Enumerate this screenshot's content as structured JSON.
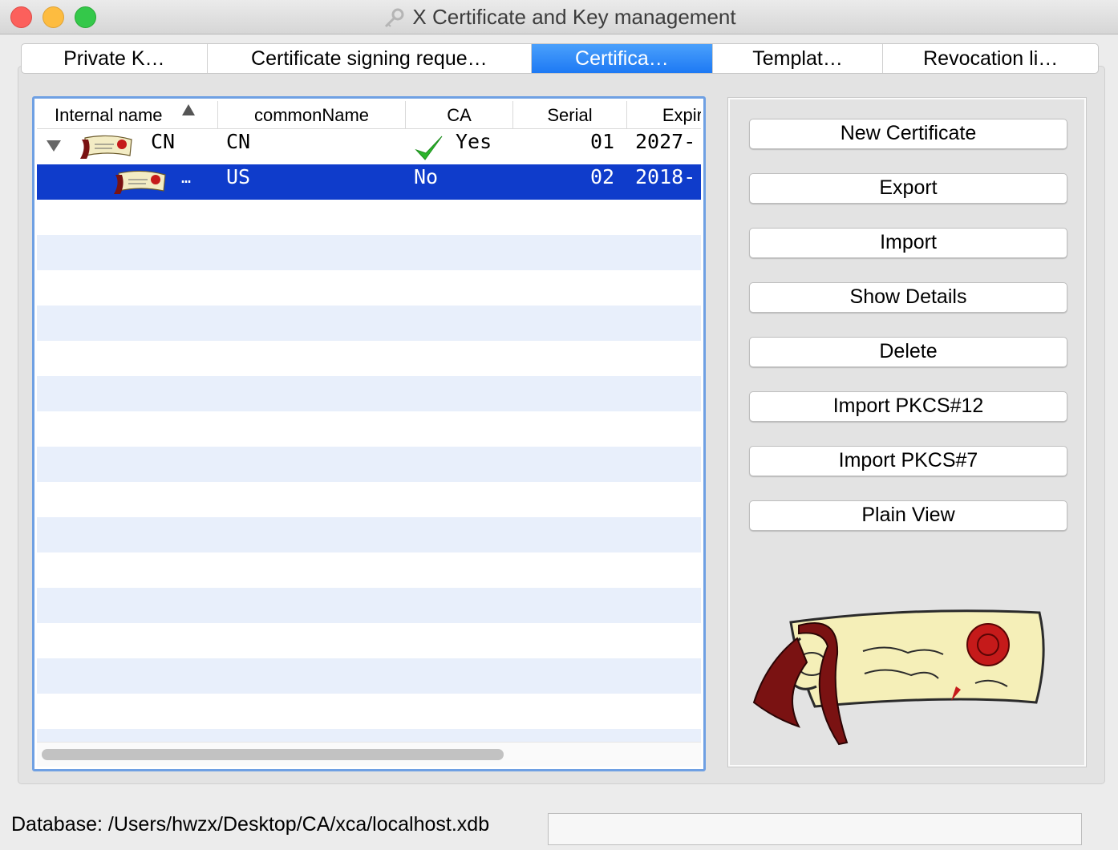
{
  "window": {
    "title": "X Certificate and Key management",
    "title_icon": "key-icon"
  },
  "tabs": [
    {
      "label": "Private K…",
      "active": false
    },
    {
      "label": "Certificate signing reque…",
      "active": false
    },
    {
      "label": "Certifica…",
      "active": true
    },
    {
      "label": "Templat…",
      "active": false
    },
    {
      "label": "Revocation li…",
      "active": false
    }
  ],
  "table": {
    "columns": [
      "Internal name",
      "commonName",
      "CA",
      "Serial",
      "Expir"
    ],
    "sort_column": "Internal name",
    "rows": [
      {
        "internal_name": "CN",
        "common_name": "CN",
        "ca": "Yes",
        "serial": "01",
        "expiry": "2027-",
        "ca_icon": "checkmark-icon",
        "expanded": true,
        "selected": false,
        "level": 0
      },
      {
        "internal_name": "…",
        "common_name": "US",
        "ca": "No",
        "serial": "02",
        "expiry": "2018-",
        "expanded": false,
        "selected": true,
        "level": 1
      }
    ]
  },
  "buttons": [
    "New Certificate",
    "Export",
    "Import",
    "Show Details",
    "Delete",
    "Import PKCS#12",
    "Import PKCS#7",
    "Plain View"
  ],
  "status": {
    "database": "Database: /Users/hwzx/Desktop/CA/xca/localhost.xdb"
  },
  "colors": {
    "active_tab": "#1d79f4",
    "selection": "#0f3ccb",
    "row_stripe": "#e8effb",
    "check": "#2bb52b"
  }
}
